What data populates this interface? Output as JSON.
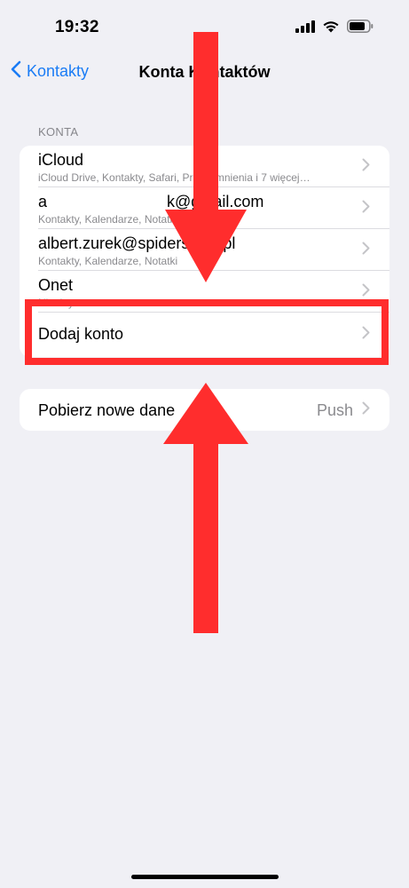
{
  "status": {
    "time": "19:32"
  },
  "nav": {
    "back_label": "Kontakty",
    "title": "Konta Kontaktów"
  },
  "section": {
    "header": "KONTA"
  },
  "accounts": [
    {
      "title": "iCloud",
      "subtitle": "iCloud Drive, Kontakty, Safari, Przypomnienia i 7 więcej…"
    },
    {
      "title": "a                           k@gmail.com",
      "subtitle": "Kontakty, Kalendarze, Notatki"
    },
    {
      "title": "albert.zurek@spidersweb.pl",
      "subtitle": "Kontakty, Kalendarze, Notatki"
    },
    {
      "title": "Onet",
      "subtitle": "Nieaktywne"
    }
  ],
  "add_account": {
    "label": "Dodaj konto"
  },
  "fetch": {
    "label": "Pobierz nowe dane",
    "value": "Push"
  },
  "colors": {
    "accent": "#1a7cf5",
    "annotation_red": "#ff2d2d",
    "background": "#f0f0f5"
  }
}
